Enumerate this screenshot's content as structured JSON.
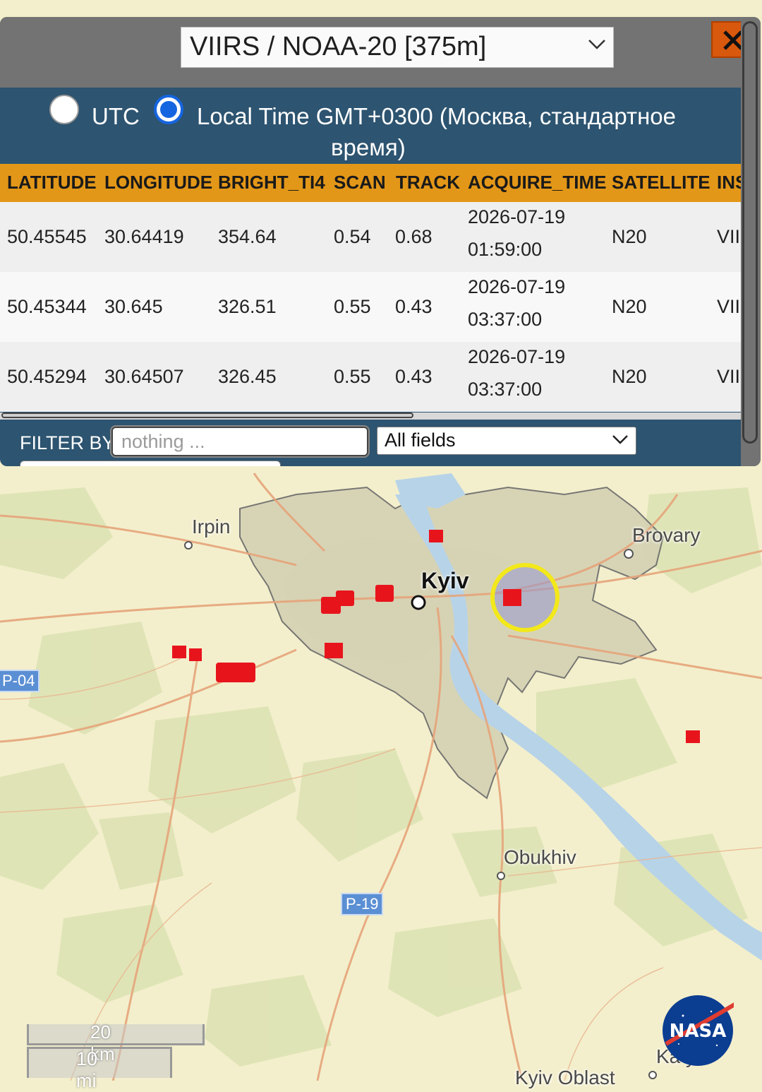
{
  "header": {
    "satellite_select": "VIIRS / NOAA-20 [375m]"
  },
  "timezone": {
    "utc_label": "UTC",
    "local_label_line1": "Local Time GMT+0300 (Москва, стандартное",
    "local_label_line2": "время)",
    "selected": "local"
  },
  "table": {
    "columns": [
      "LATITUDE",
      "LONGITUDE",
      "BRIGHT_TI4",
      "SCAN",
      "TRACK",
      "ACQUIRE_TIME",
      "SATELLITE",
      "INS"
    ],
    "rows": [
      {
        "lat": "50.45545",
        "lon": "30.64419",
        "bright": "354.64",
        "scan": "0.54",
        "track": "0.68",
        "date": "2026-07-19",
        "time": "01:59:00",
        "sat": "N20",
        "ins": "VII"
      },
      {
        "lat": "50.45344",
        "lon": "30.645",
        "bright": "326.51",
        "scan": "0.55",
        "track": "0.43",
        "date": "2026-07-19",
        "time": "03:37:00",
        "sat": "N20",
        "ins": "VII"
      },
      {
        "lat": "50.45294",
        "lon": "30.64507",
        "bright": "326.45",
        "scan": "0.55",
        "track": "0.43",
        "date": "2026-07-19",
        "time": "03:37:00",
        "sat": "N20",
        "ins": "VII"
      }
    ]
  },
  "filter": {
    "label": "FILTER BY",
    "placeholder": "nothing ...",
    "field_select": "All fields"
  },
  "map": {
    "labels": {
      "irpin": "Irpin",
      "brovary": "Brovary",
      "kyiv": "Kyiv",
      "obukhiv": "Obukhiv",
      "kaniv_partial": "Ka       yk",
      "kyiv_oblast": "Kyiv Oblast"
    },
    "road_shields": {
      "p04": "P-04",
      "p19": "P-19"
    },
    "scale": {
      "km": "20 km",
      "mi": "10 mi"
    },
    "logo": "NASA",
    "hotspot_color": "#e8141c",
    "selection_ring_color": "#f3e81a"
  },
  "icons": {
    "close": "close-icon",
    "chevron": "chevron-down-icon"
  }
}
